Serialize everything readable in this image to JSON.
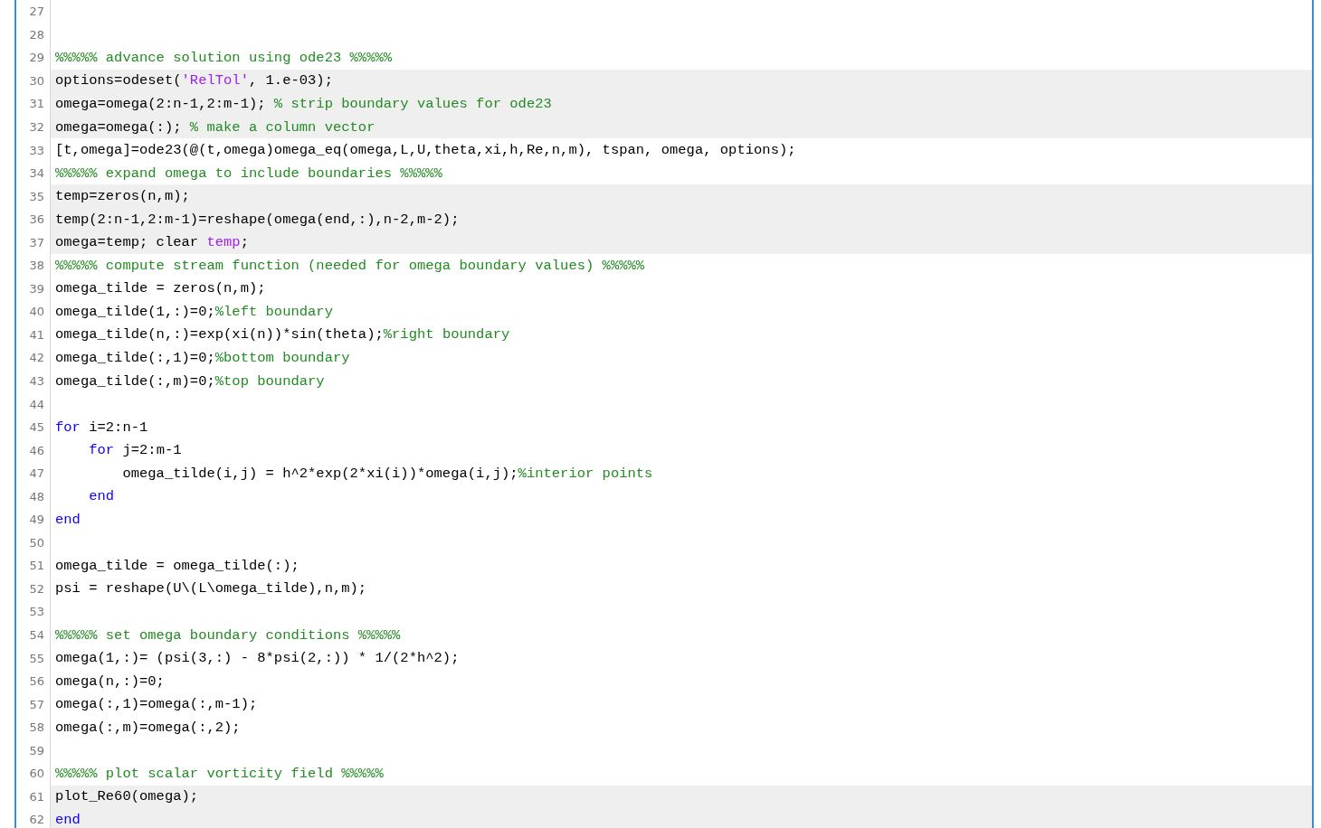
{
  "editor": {
    "lines": [
      {
        "number": "27",
        "highlighted": false
      },
      {
        "number": "28",
        "highlighted": false
      },
      {
        "number": "29",
        "highlighted": false,
        "tokens": [
          {
            "kind": "comment",
            "text": "%%%%% advance solution using ode23 %%%%%"
          }
        ]
      },
      {
        "number": "30",
        "highlighted": true,
        "tokens": [
          {
            "kind": "code",
            "text": "options=odeset("
          },
          {
            "kind": "string",
            "text": "'RelTol'"
          },
          {
            "kind": "code",
            "text": ", 1.e-03);"
          }
        ]
      },
      {
        "number": "31",
        "highlighted": true,
        "tokens": [
          {
            "kind": "code",
            "text": "omega=omega(2:n-1,2:m-1); "
          },
          {
            "kind": "comment",
            "text": "% strip boundary values for ode23"
          }
        ]
      },
      {
        "number": "32",
        "highlighted": true,
        "tokens": [
          {
            "kind": "code",
            "text": "omega=omega(:); "
          },
          {
            "kind": "comment",
            "text": "% make a column vector"
          }
        ]
      },
      {
        "number": "33",
        "highlighted": false,
        "tokens": [
          {
            "kind": "code",
            "text": "[t,omega]=ode23(@(t,omega)omega_eq(omega,L,U,theta,xi,h,Re,n,m), tspan, omega, options);"
          }
        ]
      },
      {
        "number": "34",
        "highlighted": false,
        "tokens": [
          {
            "kind": "comment",
            "text": "%%%%% expand omega to include boundaries %%%%%"
          }
        ]
      },
      {
        "number": "35",
        "highlighted": true,
        "tokens": [
          {
            "kind": "code",
            "text": "temp=zeros(n,m);"
          }
        ]
      },
      {
        "number": "36",
        "highlighted": true,
        "tokens": [
          {
            "kind": "code",
            "text": "temp(2:n-1,2:m-1)=reshape(omega(end,:),n-2,m-2);"
          }
        ]
      },
      {
        "number": "37",
        "highlighted": true,
        "tokens": [
          {
            "kind": "code",
            "text": "omega=temp; clear "
          },
          {
            "kind": "string",
            "text": "temp"
          },
          {
            "kind": "code",
            "text": ";"
          }
        ]
      },
      {
        "number": "38",
        "highlighted": false,
        "tokens": [
          {
            "kind": "comment",
            "text": "%%%%% compute stream function (needed for omega boundary values) %%%%%"
          }
        ]
      },
      {
        "number": "39",
        "highlighted": false,
        "tokens": [
          {
            "kind": "code",
            "text": "omega_tilde = zeros(n,m);"
          }
        ]
      },
      {
        "number": "40",
        "highlighted": false,
        "tokens": [
          {
            "kind": "code",
            "text": "omega_tilde(1,:)=0;"
          },
          {
            "kind": "comment",
            "text": "%left boundary"
          }
        ]
      },
      {
        "number": "41",
        "highlighted": false,
        "tokens": [
          {
            "kind": "code",
            "text": "omega_tilde(n,:)=exp(xi(n))*sin(theta);"
          },
          {
            "kind": "comment",
            "text": "%right boundary"
          }
        ]
      },
      {
        "number": "42",
        "highlighted": false,
        "tokens": [
          {
            "kind": "code",
            "text": "omega_tilde(:,1)=0;"
          },
          {
            "kind": "comment",
            "text": "%bottom boundary"
          }
        ]
      },
      {
        "number": "43",
        "highlighted": false,
        "tokens": [
          {
            "kind": "code",
            "text": "omega_tilde(:,m)=0;"
          },
          {
            "kind": "comment",
            "text": "%top boundary"
          }
        ]
      },
      {
        "number": "44",
        "highlighted": false
      },
      {
        "number": "45",
        "highlighted": false,
        "tokens": [
          {
            "kind": "keyword",
            "text": "for"
          },
          {
            "kind": "code",
            "text": " i=2:n-1"
          }
        ]
      },
      {
        "number": "46",
        "highlighted": false,
        "tokens": [
          {
            "kind": "keyword",
            "text": "    for"
          },
          {
            "kind": "code",
            "text": " j=2:m-1"
          }
        ]
      },
      {
        "number": "47",
        "highlighted": false,
        "tokens": [
          {
            "kind": "code",
            "text": "        omega_tilde(i,j) = h^2*exp(2*xi(i))*omega(i,j);"
          },
          {
            "kind": "comment",
            "text": "%interior points"
          }
        ]
      },
      {
        "number": "48",
        "highlighted": false,
        "tokens": [
          {
            "kind": "keyword",
            "text": "    end"
          }
        ]
      },
      {
        "number": "49",
        "highlighted": false,
        "tokens": [
          {
            "kind": "keyword",
            "text": "end"
          }
        ]
      },
      {
        "number": "50",
        "highlighted": false
      },
      {
        "number": "51",
        "highlighted": false,
        "tokens": [
          {
            "kind": "code",
            "text": "omega_tilde = omega_tilde(:);"
          }
        ]
      },
      {
        "number": "52",
        "highlighted": false,
        "tokens": [
          {
            "kind": "code",
            "text": "psi = reshape(U\\(L\\omega_tilde),n,m);"
          }
        ]
      },
      {
        "number": "53",
        "highlighted": false
      },
      {
        "number": "54",
        "highlighted": false,
        "tokens": [
          {
            "kind": "comment",
            "text": "%%%%% set omega boundary conditions %%%%%"
          }
        ]
      },
      {
        "number": "55",
        "highlighted": false,
        "tokens": [
          {
            "kind": "code",
            "text": "omega(1,:)= (psi(3,:) - 8*psi(2,:)) * 1/(2*h^2);"
          }
        ]
      },
      {
        "number": "56",
        "highlighted": false,
        "tokens": [
          {
            "kind": "code",
            "text": "omega(n,:)=0;"
          }
        ]
      },
      {
        "number": "57",
        "highlighted": false,
        "tokens": [
          {
            "kind": "code",
            "text": "omega(:,1)=omega(:,m-1);"
          }
        ]
      },
      {
        "number": "58",
        "highlighted": false,
        "tokens": [
          {
            "kind": "code",
            "text": "omega(:,m)=omega(:,2);"
          }
        ]
      },
      {
        "number": "59",
        "highlighted": false
      },
      {
        "number": "60",
        "highlighted": false,
        "tokens": [
          {
            "kind": "comment",
            "text": "%%%%% plot scalar vorticity field %%%%%"
          }
        ]
      },
      {
        "number": "61",
        "highlighted": true,
        "tokens": [
          {
            "kind": "code",
            "text": "plot_Re60(omega);"
          }
        ]
      },
      {
        "number": "62",
        "highlighted": true,
        "tokens": [
          {
            "kind": "keyword",
            "text": "end"
          }
        ]
      }
    ]
  }
}
